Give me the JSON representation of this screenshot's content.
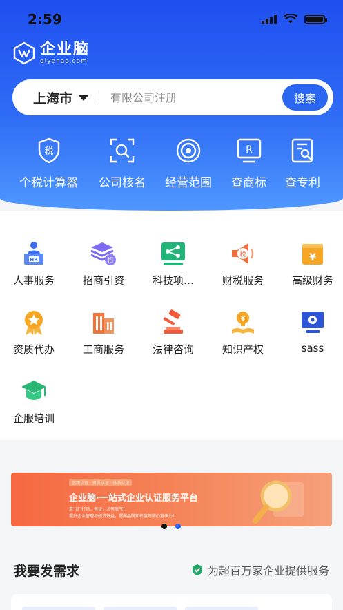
{
  "status_bar": {
    "time": "2:59"
  },
  "brand": {
    "name_cn": "企业脑",
    "name_en": "qiyenao.com"
  },
  "search": {
    "city": "上海市",
    "placeholder": "有限公司注册",
    "button": "搜索"
  },
  "quick_tools": [
    {
      "label": "个税计算器",
      "icon": "tax-shield-icon"
    },
    {
      "label": "公司核名",
      "icon": "scan-search-icon"
    },
    {
      "label": "经营范围",
      "icon": "target-icon"
    },
    {
      "label": "查商标",
      "icon": "trademark-icon"
    },
    {
      "label": "查专利",
      "icon": "patent-search-icon"
    }
  ],
  "services": [
    {
      "label": "人事服务",
      "icon": "hr-desk-icon"
    },
    {
      "label": "招商引资",
      "icon": "investment-stack-icon"
    },
    {
      "label": "科技项…",
      "icon": "tech-project-icon"
    },
    {
      "label": "财税服务",
      "icon": "tax-megaphone-icon"
    },
    {
      "label": "高级财务",
      "icon": "finance-yen-icon"
    },
    {
      "label": "资质代办",
      "icon": "medal-icon"
    },
    {
      "label": "工商服务",
      "icon": "building-icon"
    },
    {
      "label": "法律咨询",
      "icon": "gavel-icon"
    },
    {
      "label": "知识产权",
      "icon": "idea-book-icon"
    },
    {
      "label": "sass",
      "icon": "monitor-gear-icon"
    },
    {
      "label": "企服培训",
      "icon": "graduation-cap-icon"
    }
  ],
  "banner": {
    "tags": "信用认证 · 资质认证 · 体系认证",
    "title": "企业脑·一站式企业认证服务平台",
    "line1": "真“证”行动，有证，才有底气！",
    "line2": "提升企业管理与经济效益，提高品牌知名度与核心竞争力！",
    "pages": 2,
    "active_page": 1
  },
  "demand": {
    "title": "我要发需求",
    "slogan": "为超百万家企业提供服务"
  },
  "colors": {
    "primary": "#2a66f0",
    "hero_top": "#1f4ff0",
    "banner": "#f56842"
  }
}
